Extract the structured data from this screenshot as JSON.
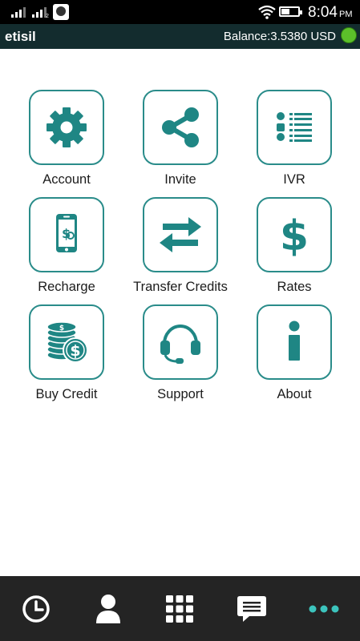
{
  "status_bar": {
    "time": "8:04",
    "ampm": "PM",
    "sim2_label": "2",
    "icons": [
      "signal-sim1-icon",
      "signal-sim2-icon",
      "app-notification-icon",
      "wifi-icon",
      "battery-icon"
    ]
  },
  "header": {
    "title": "etisil",
    "balance": "Balance:3.5380 USD",
    "status_color": "#5cbf2a"
  },
  "menu": {
    "items": [
      {
        "label": "Account",
        "icon": "gear-icon"
      },
      {
        "label": "Invite",
        "icon": "share-icon"
      },
      {
        "label": "IVR",
        "icon": "list-icon"
      },
      {
        "label": "Recharge",
        "icon": "phone-dollar-icon"
      },
      {
        "label": "Transfer Credits",
        "icon": "transfer-arrows-icon"
      },
      {
        "label": "Rates",
        "icon": "dollar-icon"
      },
      {
        "label": "Buy Credit",
        "icon": "coins-icon"
      },
      {
        "label": "Support",
        "icon": "headset-icon"
      },
      {
        "label": "About",
        "icon": "info-icon"
      }
    ]
  },
  "bottom_nav": {
    "items": [
      {
        "name": "recents",
        "icon": "clock-icon"
      },
      {
        "name": "contacts",
        "icon": "person-icon"
      },
      {
        "name": "dialpad",
        "icon": "dialpad-icon"
      },
      {
        "name": "messages",
        "icon": "chat-icon"
      },
      {
        "name": "more",
        "icon": "more-dots-icon"
      }
    ]
  },
  "colors": {
    "accent": "#2a8c8a",
    "icon_teal": "#1f8684",
    "header_bg": "#132c2e",
    "nav_bg": "#242424",
    "more_active": "#3cc4bd"
  }
}
